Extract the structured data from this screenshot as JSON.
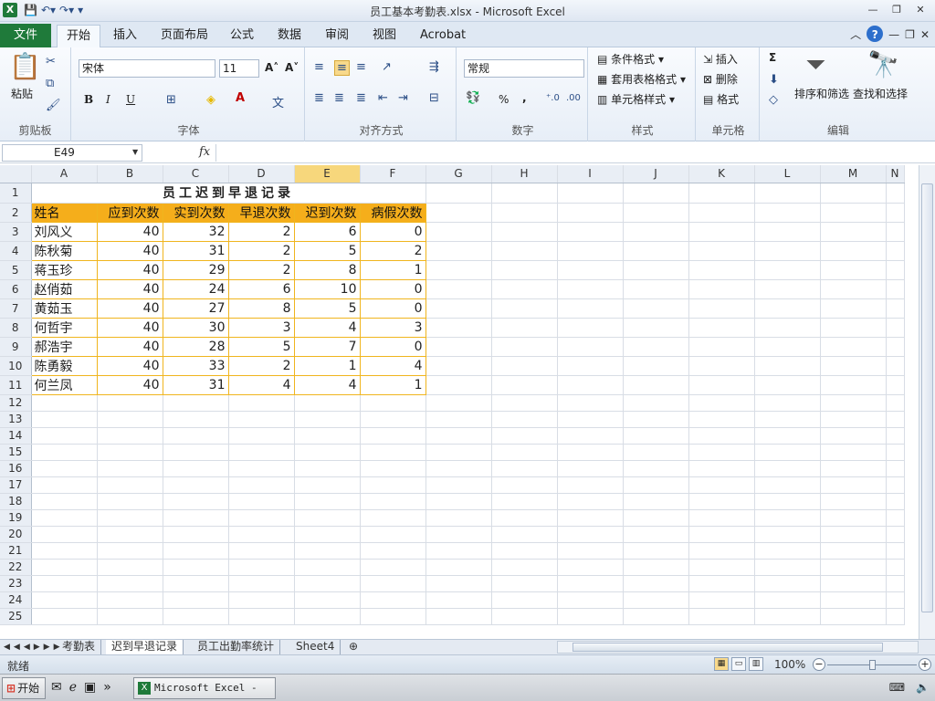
{
  "window": {
    "title": "员工基本考勤表.xlsx - Microsoft Excel",
    "app_letter": "X"
  },
  "qat": {
    "save": "💾",
    "undo": "↶▾",
    "redo": "↷▾",
    "customize": "▾"
  },
  "tabs": [
    {
      "label": "文件"
    },
    {
      "label": "开始"
    },
    {
      "label": "插入"
    },
    {
      "label": "页面布局"
    },
    {
      "label": "公式"
    },
    {
      "label": "数据"
    },
    {
      "label": "审阅"
    },
    {
      "label": "视图"
    },
    {
      "label": "Acrobat"
    }
  ],
  "ribbon": {
    "clipboard": {
      "label": "剪贴板",
      "paste": "粘贴"
    },
    "font": {
      "label": "字体",
      "name": "宋体",
      "size": "11",
      "bold": "B",
      "italic": "I",
      "underline": "U"
    },
    "alignment": {
      "label": "对齐方式"
    },
    "number": {
      "label": "数字",
      "format": "常规",
      "percent": "%",
      "comma": ","
    },
    "styles": {
      "label": "样式",
      "conditional": "条件格式",
      "table": "套用表格格式",
      "cell": "单元格样式"
    },
    "cells": {
      "label": "单元格",
      "insert": "插入",
      "delete": "删除",
      "format": "格式"
    },
    "editing": {
      "label": "编辑",
      "sum": "Σ",
      "sort": "排序和筛选",
      "find": "查找和选择"
    }
  },
  "formula_bar": {
    "name_box": "E49",
    "fx": "fx",
    "value": ""
  },
  "sheet": {
    "columns": [
      "A",
      "B",
      "C",
      "D",
      "E",
      "F",
      "G",
      "H",
      "I",
      "J",
      "K",
      "L",
      "M",
      "N"
    ],
    "selected_column": "E",
    "title": "员工迟到早退记录",
    "headers": [
      "姓名",
      "应到次数",
      "实到次数",
      "早退次数",
      "迟到次数",
      "病假次数"
    ],
    "rows": [
      [
        "刘风义",
        "40",
        "32",
        "2",
        "6",
        "0"
      ],
      [
        "陈秋菊",
        "40",
        "31",
        "2",
        "5",
        "2"
      ],
      [
        "蒋玉珍",
        "40",
        "29",
        "2",
        "8",
        "1"
      ],
      [
        "赵俏茹",
        "40",
        "24",
        "6",
        "10",
        "0"
      ],
      [
        "黄茹玉",
        "40",
        "27",
        "8",
        "5",
        "0"
      ],
      [
        "何哲宇",
        "40",
        "30",
        "3",
        "4",
        "3"
      ],
      [
        "郝浩宇",
        "40",
        "28",
        "5",
        "7",
        "0"
      ],
      [
        "陈勇毅",
        "40",
        "33",
        "2",
        "1",
        "4"
      ],
      [
        "何兰凤",
        "40",
        "31",
        "4",
        "4",
        "1"
      ]
    ],
    "row_numbers": [
      "1",
      "2",
      "3",
      "4",
      "5",
      "6",
      "7",
      "8",
      "9",
      "10",
      "11",
      "12",
      "13",
      "14",
      "15",
      "16",
      "17",
      "18",
      "19",
      "20",
      "21",
      "22",
      "23",
      "24",
      "25"
    ]
  },
  "sheet_tabs": [
    {
      "label": "考勤表"
    },
    {
      "label": "迟到早退记录"
    },
    {
      "label": "员工出勤率统计"
    },
    {
      "label": "Sheet4"
    }
  ],
  "status": {
    "ready": "就绪",
    "zoom": "100%"
  },
  "taskbar": {
    "start": "开始",
    "task": "Microsoft Excel - ..."
  },
  "colors": {
    "accent": "#1f7a3a",
    "header_fill": "#f5ae1b",
    "border": "#f0b51e"
  }
}
